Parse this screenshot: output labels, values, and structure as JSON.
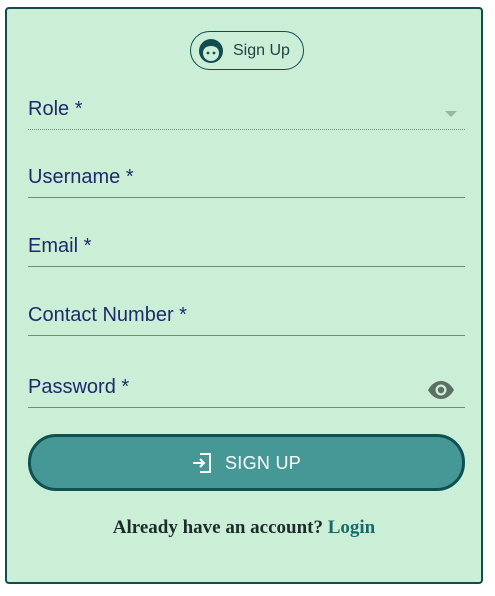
{
  "header": {
    "chip_label": "Sign Up",
    "chip_icon": "face-icon"
  },
  "form": {
    "role": {
      "label": "Role *",
      "value": ""
    },
    "username": {
      "label": "Username *",
      "value": ""
    },
    "email": {
      "label": "Email *",
      "value": ""
    },
    "contact": {
      "label": "Contact Number *",
      "value": ""
    },
    "password": {
      "label": "Password *",
      "value": "",
      "toggle_icon": "eye-icon"
    }
  },
  "submit": {
    "label": "SIGN UP",
    "icon": "login-icon"
  },
  "footer": {
    "prompt": "Already have an account?",
    "link_label": "Login"
  },
  "colors": {
    "card_background": "#cbeed7",
    "border": "#0f4d4f",
    "label_text": "#1f2a6b",
    "button_fill": "#459895",
    "button_border": "#0f5152",
    "link": "#1a6a6b"
  }
}
